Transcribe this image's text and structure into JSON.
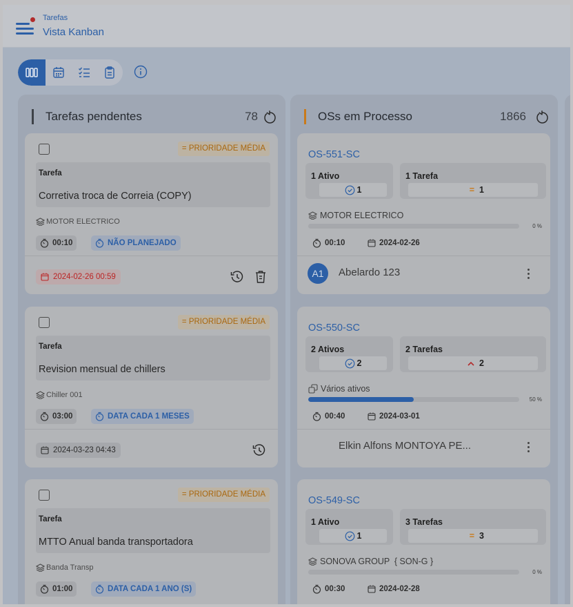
{
  "header": {
    "breadcrumb": "Tarefas",
    "title": "Vista Kanban"
  },
  "toolbar": {
    "views": [
      {
        "icon": "kanban-columns-icon",
        "active": true
      },
      {
        "icon": "calendar-icon",
        "active": false
      },
      {
        "icon": "checklist-icon",
        "active": false
      },
      {
        "icon": "clipboard-icon",
        "active": false
      }
    ],
    "info_icon": "info-icon"
  },
  "colors": {
    "accent": "#2c5fa6",
    "pending_bar": "#3e4248",
    "process_bar": "#c97a1a",
    "priority": "#a9670e",
    "overdue": "#bb2424"
  },
  "columns": [
    {
      "title": "Tarefas pendentes",
      "count": "78",
      "cards": [
        {
          "priority": "PRIORIDADE MÉDIA",
          "label": "Tarefa",
          "name": "Corretiva troca de Correia (COPY)",
          "asset": "MOTOR ELECTRICO",
          "time": "00:10",
          "schedule": "NÃO PLANEJADO",
          "date": "2024-02-26 00:59",
          "overdue": true,
          "delete": true
        },
        {
          "priority": "PRIORIDADE MÉDIA",
          "label": "Tarefa",
          "name": "Revision mensual de chillers",
          "asset": "Chiller 001",
          "time": "03:00",
          "schedule": "DATA CADA 1 MESES",
          "date": "2024-03-23 04:43",
          "overdue": false,
          "delete": false
        },
        {
          "priority": "PRIORIDADE MÉDIA",
          "label": "Tarefa",
          "name": "MTTO Anual banda transportadora",
          "asset": "Banda Transp",
          "time": "01:00",
          "schedule": "DATA CADA 1 ANO (S)"
        }
      ]
    },
    {
      "title": "OSs em Processo",
      "count": "1866",
      "cards": [
        {
          "id": "OS-551-SC",
          "assets_label": "1 Ativo",
          "assets_value": "1",
          "tasks_label": "1 Tarefa",
          "tasks_value": "1",
          "tasks_icon": "equals-icon",
          "asset": "MOTOR ELECTRICO",
          "asset_icon": "layers-icon",
          "progress": 0,
          "progress_label": "0 %",
          "time": "00:10",
          "date": "2024-02-26",
          "avatar": "A1",
          "assignee": "Abelardo 123"
        },
        {
          "id": "OS-550-SC",
          "assets_label": "2 Ativos",
          "assets_value": "2",
          "tasks_label": "2 Tarefas",
          "tasks_value": "2",
          "tasks_icon": "chevron-up-icon",
          "asset": "Vários ativos",
          "asset_icon": "copy-icon",
          "progress": 50,
          "progress_label": "50 %",
          "time": "00:40",
          "date": "2024-03-01",
          "avatar": "",
          "assignee": "Elkin Alfons MONTOYA PE..."
        },
        {
          "id": "OS-549-SC",
          "assets_label": "1 Ativo",
          "assets_value": "1",
          "tasks_label": "3 Tarefas",
          "tasks_value": "3",
          "tasks_icon": "equals-icon",
          "asset": "SONOVA GROUP  { SON-G }",
          "asset_icon": "layers-icon",
          "progress": 0,
          "progress_label": "0 %",
          "time": "00:30",
          "date": "2024-02-28"
        }
      ]
    }
  ]
}
